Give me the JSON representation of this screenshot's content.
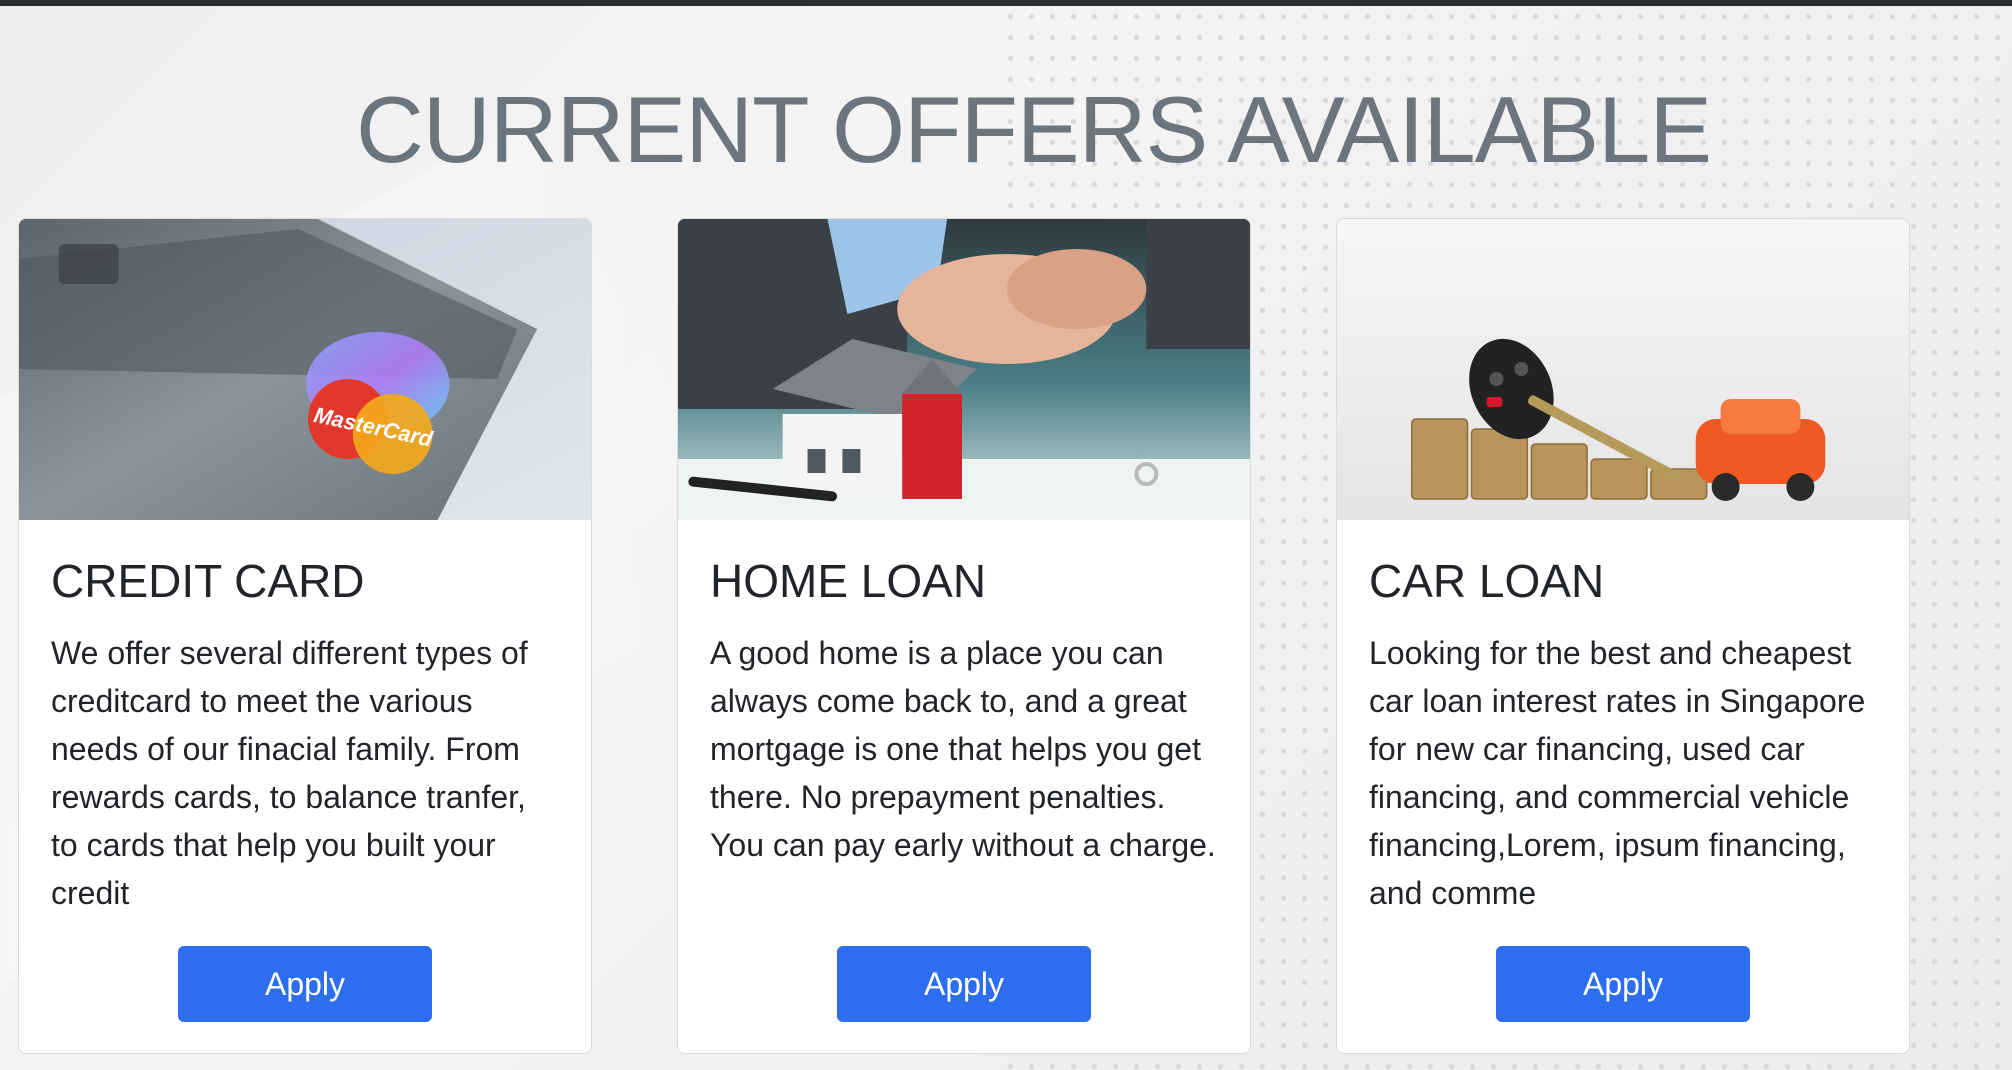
{
  "heading": "CURRENT OFFERS AVAILABLE",
  "cards": [
    {
      "title": "CREDIT CARD",
      "text": "We offer several different types of creditcard to meet the various needs of our finacial family. From rewards cards, to balance tranfer, to cards that help you built your credit",
      "button": "Apply",
      "image_label": "MasterCard"
    },
    {
      "title": "HOME LOAN",
      "text": "A good home is a place you can always come back to, and a great mortgage is one that helps you get there. No prepayment penalties. You can pay early without a charge.",
      "button": "Apply"
    },
    {
      "title": "CAR LOAN",
      "text": "Looking for the best and cheapest car loan interest rates in Singapore for new car financing, used car financing, and commercial vehicle financing,Lorem, ipsum financing, and comme",
      "button": "Apply"
    }
  ],
  "colors": {
    "heading": "#6c757d",
    "button": "#2d6ef0",
    "topbar": "#2a2d31"
  }
}
